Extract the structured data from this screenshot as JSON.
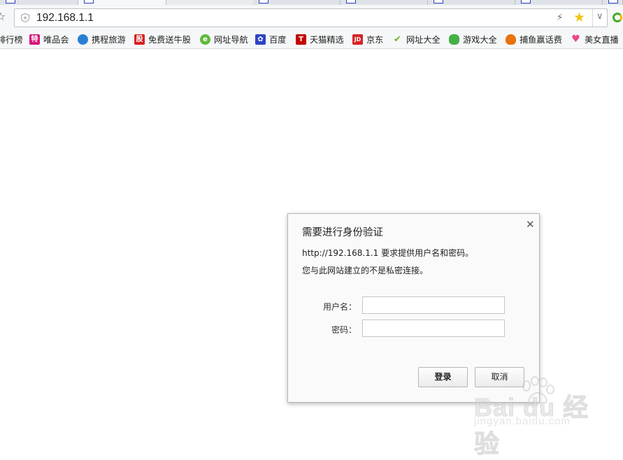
{
  "browser": {
    "url": "192.168.1.1",
    "bookmarks": [
      {
        "label": "排行榜",
        "icon": "ranking-icon",
        "badge": "",
        "color": "#888888"
      },
      {
        "label": "唯品会",
        "icon": "vip-icon",
        "badge": "特",
        "color": "#d6187a"
      },
      {
        "label": "携程旅游",
        "icon": "ctrip-icon",
        "badge": "",
        "color": "#2a7fd4"
      },
      {
        "label": "免费送牛股",
        "icon": "stock-icon",
        "badge": "股",
        "color": "#d62020"
      },
      {
        "label": "网址导航",
        "icon": "ie-icon",
        "badge": "e",
        "color": "#5fb93a"
      },
      {
        "label": "百度",
        "icon": "baidu-paw-icon",
        "badge": "",
        "color": "#2d43c7"
      },
      {
        "label": "天猫精选",
        "icon": "tmall-icon",
        "badge": "T",
        "color": "#c40000"
      },
      {
        "label": "京东",
        "icon": "jd-icon",
        "badge": "JD",
        "color": "#d62424"
      },
      {
        "label": "网址大全",
        "icon": "hao-icon",
        "badge": "",
        "color": "#6bb52d"
      },
      {
        "label": "游戏大全",
        "icon": "gamepad-icon",
        "badge": "",
        "color": "#45b045"
      },
      {
        "label": "捕鱼赢话费",
        "icon": "fish-icon",
        "badge": "",
        "color": "#e8720c"
      },
      {
        "label": "美女直播",
        "icon": "heart-icon",
        "badge": "",
        "color": "#e8458b"
      }
    ]
  },
  "dialog": {
    "title": "需要进行身份验证",
    "message_line1": "http://192.168.1.1 要求提供用户名和密码。",
    "message_line2": "您与此网站建立的不是私密连接。",
    "username_label": "用户名：",
    "password_label": "密码：",
    "username_value": "",
    "password_value": "",
    "login_button": "登录",
    "cancel_button": "取消"
  },
  "watermark": {
    "brand": "Bai du 经验",
    "sub": "jingyan.baidu.com"
  }
}
